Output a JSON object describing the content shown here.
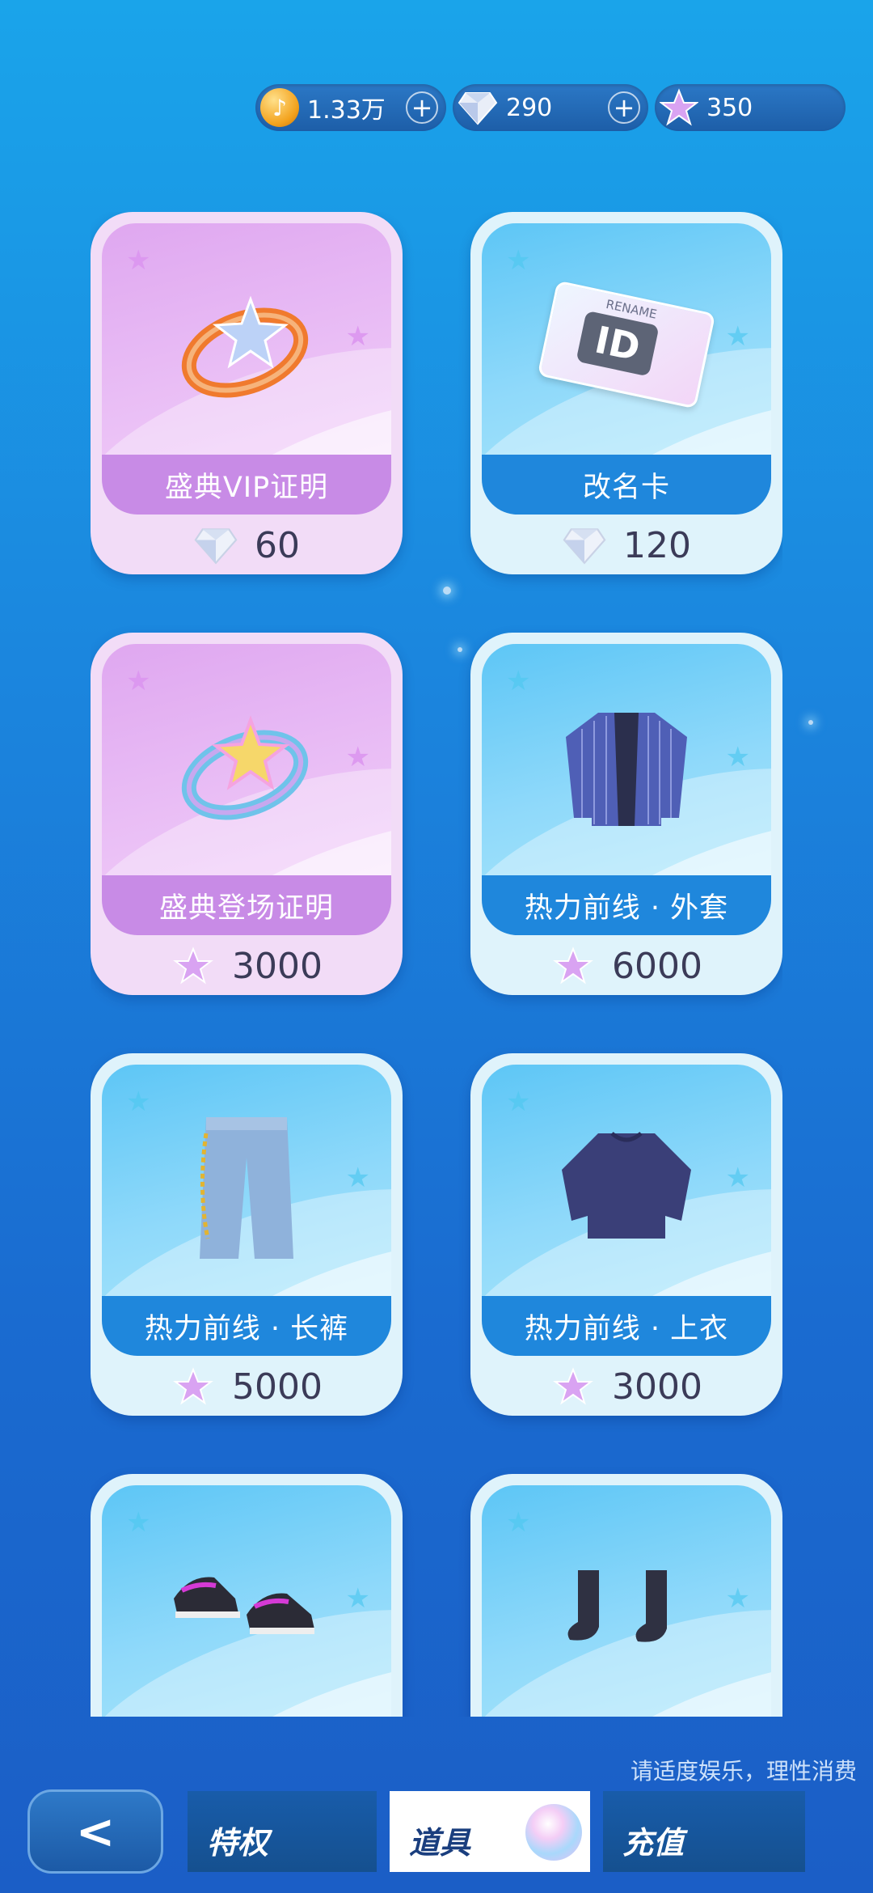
{
  "currency": {
    "coins": "1.33万",
    "diamonds": "290",
    "stars": "350",
    "plus_symbol": "+"
  },
  "items": [
    {
      "name": "盛典VIP证明",
      "price": "60",
      "currency": "diamond",
      "theme": "purple"
    },
    {
      "name": "改名卡",
      "price": "120",
      "currency": "diamond",
      "theme": "blue"
    },
    {
      "name": "盛典登场证明",
      "price": "3000",
      "currency": "star",
      "theme": "purple"
    },
    {
      "name": "热力前线 · 外套",
      "price": "6000",
      "currency": "star",
      "theme": "blue"
    },
    {
      "name": "热力前线 · 长裤",
      "price": "5000",
      "currency": "star",
      "theme": "blue"
    },
    {
      "name": "热力前线 · 上衣",
      "price": "3000",
      "currency": "star",
      "theme": "blue"
    },
    {
      "name": "",
      "price": "",
      "currency": "star",
      "theme": "blue"
    },
    {
      "name": "",
      "price": "",
      "currency": "star",
      "theme": "blue"
    }
  ],
  "rename_card_text": {
    "top": "RENAME",
    "id": "ID"
  },
  "notice": "请适度娱乐，理性消费",
  "nav": {
    "back": "<",
    "tabs": [
      "特权",
      "道具",
      "充值"
    ],
    "active_tab": "道具"
  },
  "colors": {
    "accent_blue": "#1f87dc",
    "accent_purple": "#c88be6",
    "price_text": "#3b3b58"
  }
}
